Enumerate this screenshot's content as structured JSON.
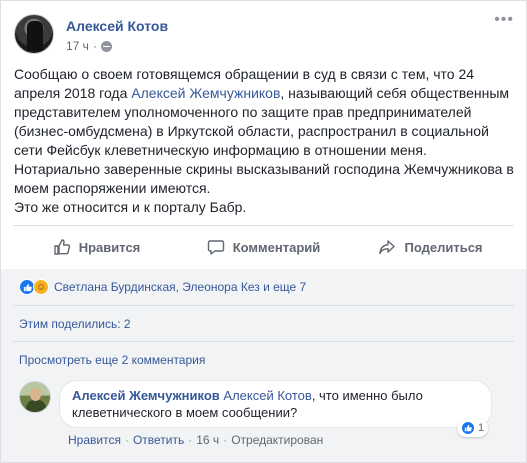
{
  "post": {
    "author": "Алексей Котов",
    "time": "17 ч",
    "text_part1": "Сообщаю о своем готовящемся обращении в суд в связи с тем, что 24 апреля 2018 года ",
    "text_link": "Алексей Жемчужников",
    "text_part2": ", называющий себя общественным представителем уполномоченного по защите прав предпринимателей (бизнес-омбудсмена) в Иркутской области, распространил в социальной сети Фейсбук клеветническую информацию в отношении меня. Нотариально заверенные скрины высказываний господина Жемчужникова в моем распоряжении имеются.",
    "text_line2": "Это же относится и к порталу Бабр."
  },
  "actions": {
    "like": "Нравится",
    "comment": "Комментарий",
    "share": "Поделиться"
  },
  "reactions": {
    "summary": "Светлана Бурдинская, Элеонора Кез и еще 7",
    "shares": "Этим поделились: 2",
    "prev_comments": "Просмотреть еще 2 комментария"
  },
  "comment": {
    "author": "Алексей Жемчужников",
    "mention": "Алексей Котов",
    "text": ", что именно было клеветнического в моем сообщении?",
    "like": "Нравится",
    "reply": "Ответить",
    "time": "16 ч",
    "edited": "Отредактирован",
    "reaction_count": "1"
  },
  "colors": {
    "link": "#365899",
    "like_blue": "#1877f2",
    "haha_yellow": "#f7b125"
  }
}
